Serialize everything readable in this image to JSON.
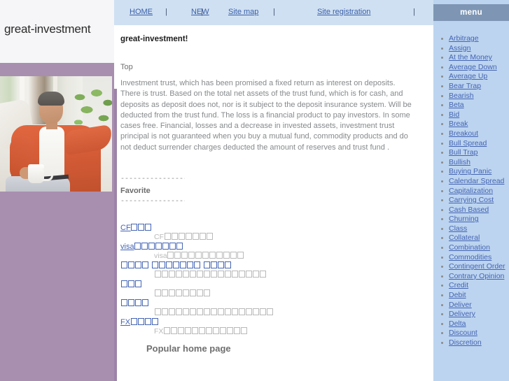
{
  "site": {
    "title": "great-investment"
  },
  "topnav": {
    "links": [
      {
        "label": "HOME"
      },
      {
        "label": "NEW"
      },
      {
        "label": "Site map"
      },
      {
        "label": "Site registration"
      }
    ],
    "separator": "|"
  },
  "content": {
    "heading": "great-investment!",
    "top_label": "Top",
    "paragraph": "Investment trust, which has been promised a fixed return as interest on deposits. There is trust. Based on the total net assets of the trust fund, which is for cash, and deposits as deposit does not, nor is it subject to the deposit insurance system. Will be deducted from the trust fund. The loss is a financial product to pay investors. In some cases free. Financial, losses and a decrease in invested assets, investment trust principal is not guaranteed when you buy a mutual fund, commodity products and do not deduct surrender charges deducted the amount of reserves and trust fund .",
    "divider": "------------------------",
    "favorite_title": "Favorite",
    "popular_heading": "Popular home page",
    "favorites": [
      {
        "link_prefix": "CF",
        "link_boxes": 3,
        "desc_prefix": "CF",
        "desc_boxes": 7
      },
      {
        "link_prefix": "visa",
        "link_boxes": 7,
        "desc_prefix": "visa",
        "desc_boxes": 11
      },
      {
        "link_prefix": "",
        "link_boxes": 4,
        "link_prefix2": "",
        "link_boxes2": 7,
        "link_boxes3": 4,
        "desc_prefix": "",
        "desc_boxes": 16
      },
      {
        "link_prefix": "",
        "link_boxes": 3,
        "desc_prefix": "",
        "desc_boxes": 8
      },
      {
        "link_prefix": "",
        "link_boxes": 4,
        "desc_prefix": "",
        "desc_boxes": 17
      },
      {
        "link_prefix": "FX",
        "link_boxes": 4,
        "desc_prefix": "FX",
        "desc_boxes": 12
      }
    ]
  },
  "sidebar": {
    "header": "menu",
    "items": [
      {
        "label": "Arbitrage"
      },
      {
        "label": "Assign"
      },
      {
        "label": "At the Money"
      },
      {
        "label": "Average Down"
      },
      {
        "label": "Average Up"
      },
      {
        "label": "Bear Trap"
      },
      {
        "label": "Bearish"
      },
      {
        "label": "Beta"
      },
      {
        "label": "Bid"
      },
      {
        "label": "Break"
      },
      {
        "label": "Breakout"
      },
      {
        "label": "Bull Spread"
      },
      {
        "label": "Bull Trap"
      },
      {
        "label": "Bullish"
      },
      {
        "label": "Buying Panic"
      },
      {
        "label": "Calendar Spread"
      },
      {
        "label": "Capitalization"
      },
      {
        "label": "Carrying Cost"
      },
      {
        "label": "Cash Based"
      },
      {
        "label": "Churning"
      },
      {
        "label": "Class"
      },
      {
        "label": "Collateral"
      },
      {
        "label": "Combination"
      },
      {
        "label": "Commodities"
      },
      {
        "label": "Contingent Order"
      },
      {
        "label": "Contrary Opinion"
      },
      {
        "label": "Credit"
      },
      {
        "label": "Debit"
      },
      {
        "label": "Deliver"
      },
      {
        "label": "Delivery"
      },
      {
        "label": "Delta"
      },
      {
        "label": "Discount"
      },
      {
        "label": "Discretion"
      }
    ]
  },
  "colors": {
    "nav_bg": "#cfe0f2",
    "sidebar_bg": "#bcd4ef",
    "menu_header_bg": "#7e96b4",
    "purple_band": "#a88fb0",
    "link": "#4464b4"
  }
}
